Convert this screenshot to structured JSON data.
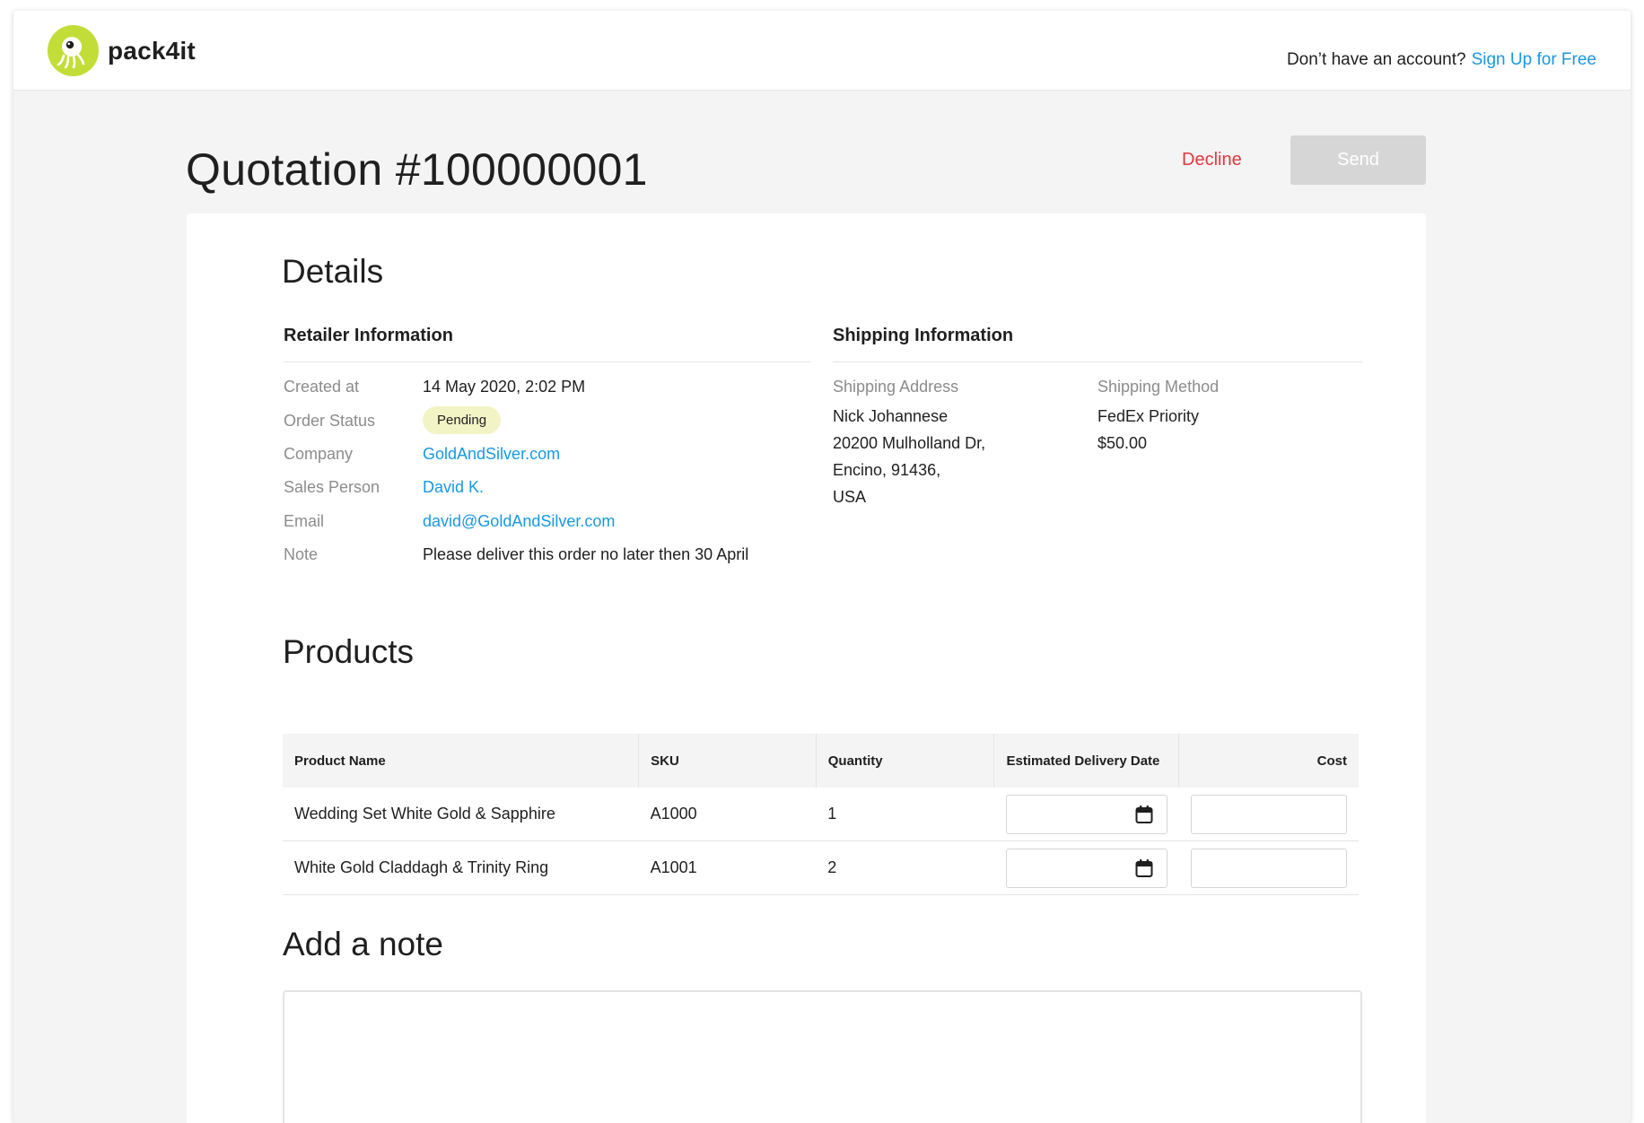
{
  "header": {
    "logo_text": "pack4it",
    "signup_prompt": "Don’t have an account?",
    "signup_link": "Sign Up for Free",
    "brand_color": "#c3dd38",
    "link_color": "#1998e0"
  },
  "page": {
    "title": "Quotation #100000001",
    "decline_label": "Decline",
    "send_label": "Send"
  },
  "details": {
    "heading": "Details",
    "retailer": {
      "heading": "Retailer Information",
      "created_label": "Created at",
      "created_value": "14 May 2020, 2:02 PM",
      "status_label": "Order Status",
      "status_value": "Pending",
      "company_label": "Company",
      "company_value": "GoldAndSilver.com",
      "sales_label": "Sales Person",
      "sales_value": "David K.",
      "email_label": "Email",
      "email_value": "david@GoldAndSilver.com",
      "note_label": "Note",
      "note_value": "Please deliver this order no later then 30 April"
    },
    "shipping": {
      "heading": "Shipping Information",
      "address_label": "Shipping Address",
      "address_lines": [
        "Nick Johannese",
        "20200 Mulholland Dr,",
        "Encino, 91436,",
        "USA"
      ],
      "method_label": "Shipping Method",
      "method_value": "FedEx Priority",
      "method_cost": "$50.00"
    }
  },
  "products": {
    "heading": "Products",
    "columns": [
      "Product Name",
      "SKU",
      "Quantity",
      "Estimated Delivery Date",
      "Cost"
    ],
    "rows": [
      {
        "name": "Wedding Set White Gold & Sapphire",
        "sku": "A1000",
        "qty": "1"
      },
      {
        "name": "White Gold Claddagh & Trinity Ring",
        "sku": "A1001",
        "qty": "2"
      }
    ]
  },
  "note": {
    "heading": "Add a note"
  }
}
